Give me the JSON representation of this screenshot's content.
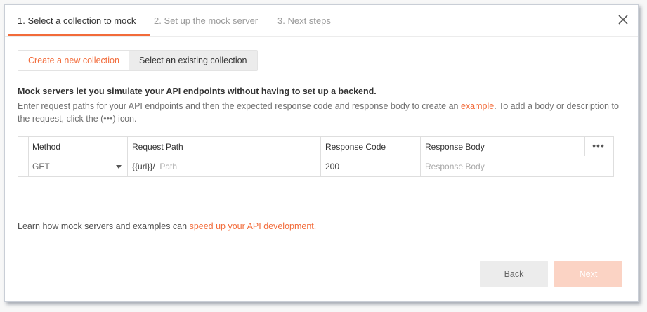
{
  "wizard": {
    "tabs": [
      {
        "label": "1. Select a collection to mock",
        "active": true
      },
      {
        "label": "2. Set up the mock server",
        "active": false
      },
      {
        "label": "3. Next steps",
        "active": false
      }
    ],
    "close_icon": "close-x-icon"
  },
  "collection_choice": {
    "new_label": "Create a new collection",
    "existing_label": "Select an existing collection",
    "selected": "new"
  },
  "intro": {
    "heading": "Mock servers let you simulate your API endpoints without having to set up a backend.",
    "desc_part1": "Enter request paths for your API endpoints and then the expected response code and response body to create an ",
    "desc_link": "example",
    "desc_part2": ". To add a body or description to the request, click the (•••) icon."
  },
  "request_table": {
    "headers": {
      "method": "Method",
      "path": "Request Path",
      "code": "Response Code",
      "body": "Response Body"
    },
    "more_icon": "•••",
    "row": {
      "method": "GET",
      "path_prefix": "{{url}}/",
      "path_placeholder": "Path",
      "code": "200",
      "body_placeholder": "Response Body"
    }
  },
  "footer": {
    "note_text": "Learn how mock servers and examples can ",
    "note_link": "speed up your API development.",
    "back_label": "Back",
    "next_label": "Next"
  },
  "colors": {
    "accent": "#f26b3a",
    "next_disabled": "#fbd3c4",
    "back_bg": "#ececec"
  }
}
